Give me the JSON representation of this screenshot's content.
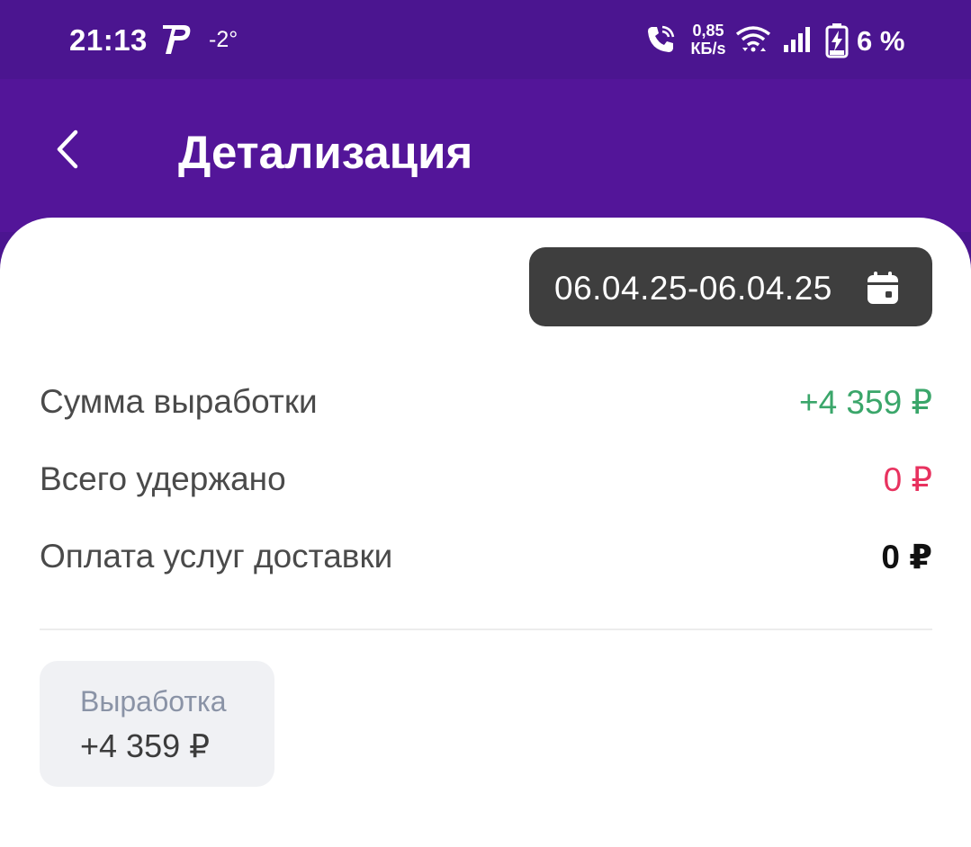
{
  "status_bar": {
    "time": "21:13",
    "app_logo": "Р",
    "temperature": "-2°",
    "net_speed_value": "0,85",
    "net_speed_unit": "КБ/s",
    "battery_percent": "6 %",
    "icons": [
      "p-logo-icon",
      "wifi-call-icon",
      "wifi-icon",
      "signal-icon",
      "battery-charging-icon"
    ]
  },
  "header": {
    "back_icon": "chevron-left-icon",
    "title": "Детализация"
  },
  "date_filter": {
    "range": "06.04.25-06.04.25",
    "icon": "calendar-icon"
  },
  "summary": [
    {
      "label": "Сумма выработки",
      "value": "+4 359 ₽",
      "color": "#3aa66a"
    },
    {
      "label": "Всего удержано",
      "value": "0 ₽",
      "color": "#e8325f"
    },
    {
      "label": "Оплата услуг доставки",
      "value": "0 ₽",
      "color": "#111111"
    }
  ],
  "chips": [
    {
      "label": "Выработка",
      "value": "+4 359 ₽"
    }
  ],
  "colors": {
    "status_bar": "#4b1590",
    "app_bar": "#531599",
    "date_button": "#3e3e3e",
    "chip_bg": "#f0f1f4"
  }
}
